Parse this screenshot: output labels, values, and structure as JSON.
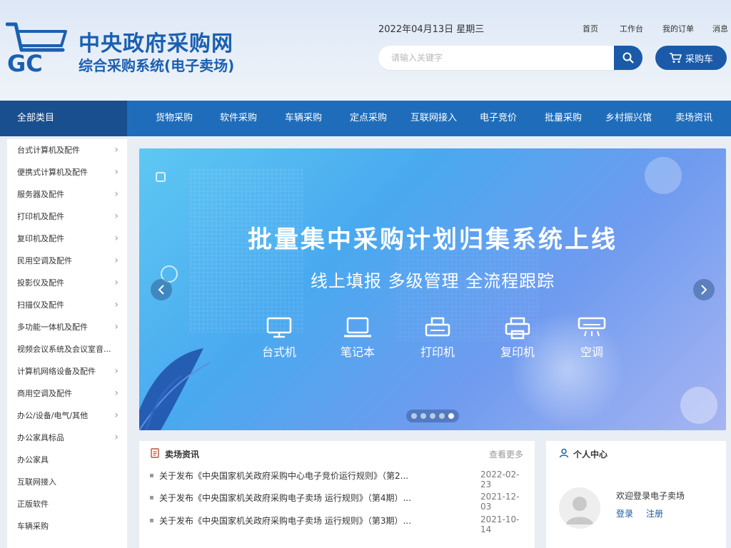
{
  "header": {
    "logo_text": "GC",
    "title": "中央政府采购网",
    "subtitle": "综合采购系统(电子卖场)",
    "date": "2022年04月13日 星期三",
    "top_links": [
      "首页",
      "工作台",
      "我的订单",
      "消息"
    ],
    "search": {
      "placeholder": "请输入关键字",
      "value": ""
    },
    "cart_label": "采购车"
  },
  "nav": {
    "all_categories": "全部类目",
    "items": [
      "货物采购",
      "软件采购",
      "车辆采购",
      "定点采购",
      "互联网接入",
      "电子竞价",
      "批量采购",
      "乡村振兴馆",
      "卖场资讯"
    ]
  },
  "sidebar": {
    "items": [
      {
        "label": "台式计算机及配件",
        "arrow": true
      },
      {
        "label": "便携式计算机及配件",
        "arrow": true
      },
      {
        "label": "服务器及配件",
        "arrow": true
      },
      {
        "label": "打印机及配件",
        "arrow": true
      },
      {
        "label": "复印机及配件",
        "arrow": true
      },
      {
        "label": "民用空调及配件",
        "arrow": true
      },
      {
        "label": "投影仪及配件",
        "arrow": true
      },
      {
        "label": "扫描仪及配件",
        "arrow": true
      },
      {
        "label": "多功能一体机及配件",
        "arrow": true
      },
      {
        "label": "视频会议系统及会议室音...",
        "arrow": false
      },
      {
        "label": "计算机网络设备及配件",
        "arrow": true
      },
      {
        "label": "商用空调及配件",
        "arrow": true
      },
      {
        "label": "办公/设备/电气/其他",
        "arrow": true
      },
      {
        "label": "办公家具标品",
        "arrow": true
      },
      {
        "label": "办公家具",
        "arrow": false
      },
      {
        "label": "互联网接入",
        "arrow": false
      },
      {
        "label": "正版软件",
        "arrow": false
      },
      {
        "label": "车辆采购",
        "arrow": false
      }
    ]
  },
  "banner": {
    "title": "批量集中采购计划归集系统上线",
    "subtitle": "线上填报 多级管理 全流程跟踪",
    "icons": [
      {
        "label": "台式机",
        "icon": "desktop-icon"
      },
      {
        "label": "笔记本",
        "icon": "laptop-icon"
      },
      {
        "label": "打印机",
        "icon": "printer-icon"
      },
      {
        "label": "复印机",
        "icon": "copier-icon"
      },
      {
        "label": "空调",
        "icon": "air-conditioner-icon"
      }
    ],
    "slide_count": 5,
    "active_slide": 5
  },
  "news": {
    "title": "卖场资讯",
    "more": "查看更多",
    "items": [
      {
        "text": "关于发布《中央国家机关政府采购中心电子竞价运行规则》（第2...",
        "date": "2022-02-23"
      },
      {
        "text": "关于发布《中央国家机关政府采购电子卖场 运行规则》（第4期）...",
        "date": "2021-12-03"
      },
      {
        "text": "关于发布《中央国家机关政府采购电子卖场 运行规则》（第3期）...",
        "date": "2021-10-14"
      }
    ]
  },
  "user": {
    "title": "个人中心",
    "welcome": "欢迎登录电子卖场",
    "login": "登录",
    "register": "注册"
  },
  "colors": {
    "brand_blue": "#1b5fb0",
    "nav_blue": "#1f6dba",
    "nav_dark": "#1a4f8f",
    "button_blue": "#1a5aa8"
  }
}
